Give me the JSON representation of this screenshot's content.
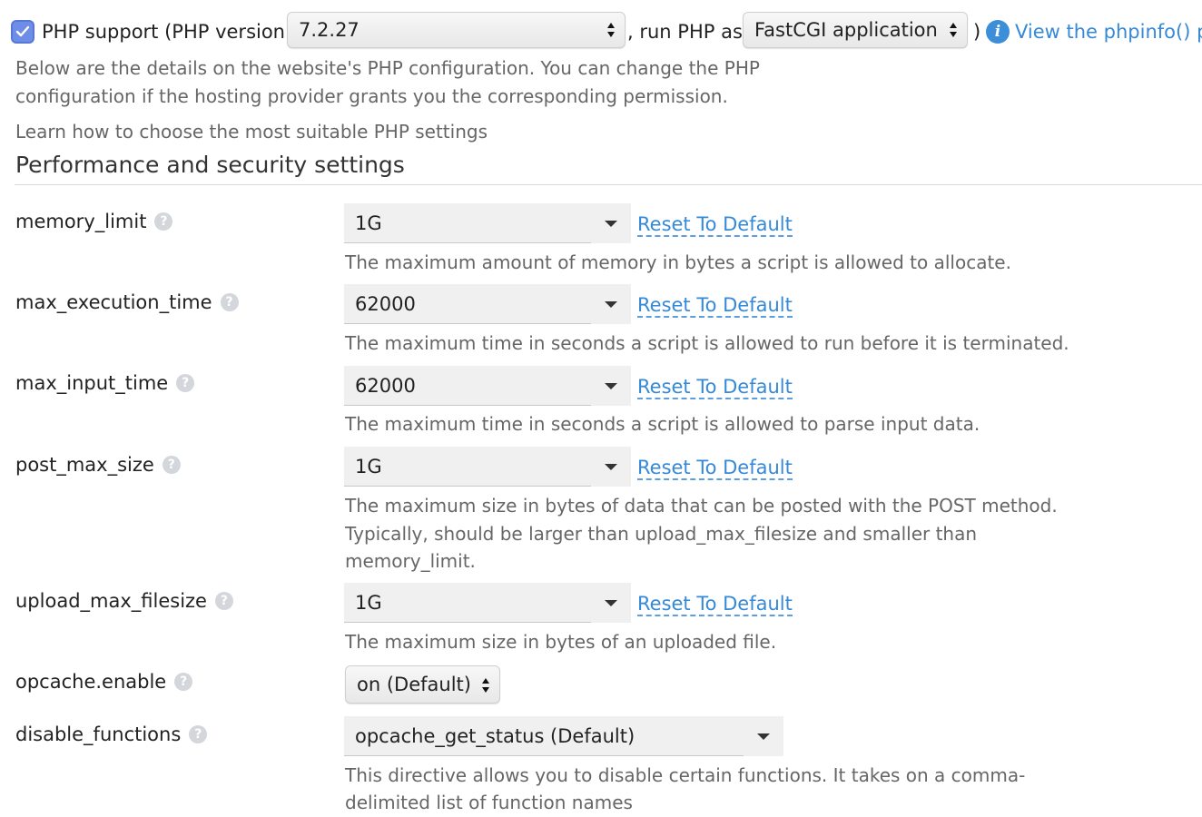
{
  "php_support": {
    "checked": true,
    "label": "PHP support (PHP version",
    "version_value": "7.2.27",
    "run_as_text": ", run PHP as",
    "handler_value": "FastCGI application",
    "close_paren": ")",
    "info_glyph": "i",
    "phpinfo_link": "View the phpinfo() p"
  },
  "intro": {
    "line1": "Below are the details on the website's PHP configuration. You can change the PHP",
    "line2": "configuration if the hosting provider grants you the corresponding permission.",
    "learn_link": "Learn how to choose the most suitable PHP settings"
  },
  "section": {
    "title": "Performance and security settings"
  },
  "help_glyph": "?",
  "reset_label": "Reset To Default",
  "settings": [
    {
      "name": "memory_limit",
      "value": "1G",
      "desc": [
        "The maximum amount of memory in bytes a script is allowed to allocate."
      ]
    },
    {
      "name": "max_execution_time",
      "value": "62000",
      "desc": [
        "The maximum time in seconds a script is allowed to run before it is terminated."
      ]
    },
    {
      "name": "max_input_time",
      "value": "62000",
      "desc": [
        "The maximum time in seconds a script is allowed to parse input data."
      ]
    },
    {
      "name": "post_max_size",
      "value": "1G",
      "desc": [
        "The maximum size in bytes of data that can be posted with the POST method.",
        "Typically, should be larger than upload_max_filesize and smaller than",
        "memory_limit."
      ]
    },
    {
      "name": "upload_max_filesize",
      "value": "1G",
      "desc": [
        "The maximum size in bytes of an uploaded file."
      ]
    },
    {
      "name": "opcache.enable",
      "value": "on (Default)"
    },
    {
      "name": "disable_functions",
      "value": "opcache_get_status (Default)",
      "desc": [
        "This directive allows you to disable certain functions. It takes on a comma-",
        "delimited list of function names"
      ]
    }
  ],
  "colors": {
    "link": "#3589d6",
    "checkbox": "#6e8de6",
    "info": "#3c8ed8"
  }
}
